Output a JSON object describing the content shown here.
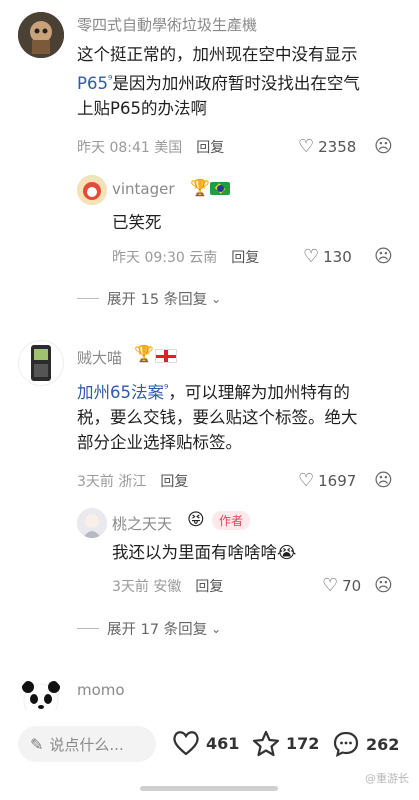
{
  "comments": [
    {
      "user": "零四式自動學術垃圾生產機",
      "text_l1": "这个挺正常的，加州现在空中没有显示",
      "text_l2_link": "P65",
      "text_l2_rest": "是因为加州政府暂时没找出在空气",
      "text_l3": "上贴P65的办法啊",
      "time": "昨天 08:41 美国",
      "reply_label": "回复",
      "likes": "2358",
      "replies": [
        {
          "user": "vintager",
          "text": "已笑死",
          "time": "昨天 09:30 云南",
          "reply_label": "回复",
          "likes": "130"
        }
      ],
      "expand_label": "展开 15 条回复"
    },
    {
      "user": "贼大喵",
      "text_l1_link": "加州65法案",
      "text_l1_rest": "，可以理解为加州特有的",
      "text_l2": "税，要么交钱，要么贴这个标签。绝大",
      "text_l3": "部分企业选择贴标签。",
      "time": "3天前 浙江",
      "reply_label": "回复",
      "likes": "1697",
      "replies": [
        {
          "user": "桃之天天",
          "author_tag": "作者",
          "text": "我还以为里面有啥啥啥",
          "time": "3天前 安徽",
          "reply_label": "回复",
          "likes": "70"
        }
      ],
      "expand_label": "展开 17 条回复"
    },
    {
      "user": "momo"
    }
  ],
  "bottom_bar": {
    "input_placeholder": "说点什么...",
    "likes": "461",
    "favorites": "172",
    "comments": "262"
  },
  "watermark": "@重游长"
}
